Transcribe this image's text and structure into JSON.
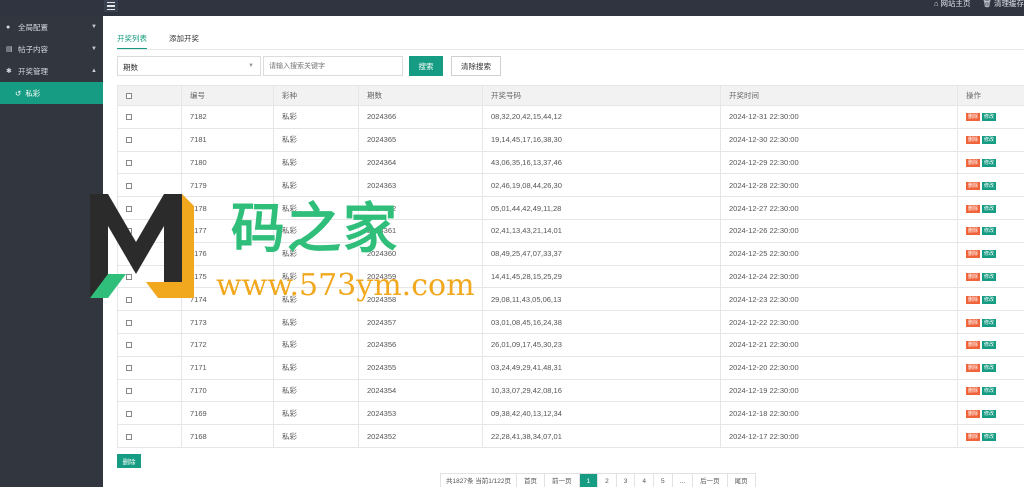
{
  "topbar": {
    "links": [
      {
        "icon": "home-icon",
        "label": "网站主页"
      },
      {
        "icon": "trash-icon",
        "label": "清理缓存"
      }
    ]
  },
  "sidebar": {
    "items": [
      {
        "icon": "globe-icon",
        "label": "全局配置"
      },
      {
        "icon": "document-icon",
        "label": "帖子内容"
      },
      {
        "icon": "gear-icon",
        "label": "开奖管理"
      }
    ],
    "sub_item": {
      "icon": "history-icon",
      "label": "私彩"
    }
  },
  "tabs": [
    "开奖列表",
    "添加开奖"
  ],
  "filter": {
    "select_value": "期数",
    "search_placeholder": "请输入搜索关键字",
    "search_label": "搜索",
    "clear_label": "清除搜索"
  },
  "table": {
    "columns": [
      "编号",
      "彩种",
      "期数",
      "开奖号码",
      "开奖时间",
      "操作"
    ],
    "delete_label": "删除",
    "edit_label": "修改",
    "rows": [
      [
        "7182",
        "私彩",
        "2024366",
        "08,32,20,42,15,44,12",
        "2024-12-31 22:30:00"
      ],
      [
        "7181",
        "私彩",
        "2024365",
        "19,14,45,17,16,38,30",
        "2024-12-30 22:30:00"
      ],
      [
        "7180",
        "私彩",
        "2024364",
        "43,06,35,16,13,37,46",
        "2024-12-29 22:30:00"
      ],
      [
        "7179",
        "私彩",
        "2024363",
        "02,46,19,08,44,26,30",
        "2024-12-28 22:30:00"
      ],
      [
        "7178",
        "私彩",
        "2024362",
        "05,01,44,42,49,11,28",
        "2024-12-27 22:30:00"
      ],
      [
        "7177",
        "私彩",
        "2024361",
        "02,41,13,43,21,14,01",
        "2024-12-26 22:30:00"
      ],
      [
        "7176",
        "私彩",
        "2024360",
        "08,49,25,47,07,33,37",
        "2024-12-25 22:30:00"
      ],
      [
        "7175",
        "私彩",
        "2024359",
        "14,41,45,28,15,25,29",
        "2024-12-24 22:30:00"
      ],
      [
        "7174",
        "私彩",
        "2024358",
        "29,08,11,43,05,06,13",
        "2024-12-23 22:30:00"
      ],
      [
        "7173",
        "私彩",
        "2024357",
        "03,01,08,45,16,24,38",
        "2024-12-22 22:30:00"
      ],
      [
        "7172",
        "私彩",
        "2024356",
        "26,01,09,17,45,30,23",
        "2024-12-21 22:30:00"
      ],
      [
        "7171",
        "私彩",
        "2024355",
        "03,24,49,29,41,48,31",
        "2024-12-20 22:30:00"
      ],
      [
        "7170",
        "私彩",
        "2024354",
        "10,33,07,29,42,08,16",
        "2024-12-19 22:30:00"
      ],
      [
        "7169",
        "私彩",
        "2024353",
        "09,38,42,40,13,12,34",
        "2024-12-18 22:30:00"
      ],
      [
        "7168",
        "私彩",
        "2024352",
        "22,28,41,38,34,07,01",
        "2024-12-17 22:30:00"
      ]
    ]
  },
  "bulk_delete_label": "删除",
  "pagination": {
    "info": "共1827条 当前1/122页",
    "first": "首页",
    "prev": "前一页",
    "pages": [
      "1",
      "2",
      "3",
      "4",
      "5"
    ],
    "current": "1",
    "ellipsis": "...",
    "next": "后一页",
    "last": "尾页"
  },
  "watermark": {
    "text_cn": "码之家",
    "url": "www.573ym.com",
    "colors": {
      "green": "#2fbf7a",
      "orange": "#f2a81e",
      "dark": "#2b2b2b"
    }
  },
  "colors": {
    "accent": "#169c82",
    "danger": "#f0643c",
    "sidebar": "#32373f",
    "topbar": "#2f3440"
  }
}
